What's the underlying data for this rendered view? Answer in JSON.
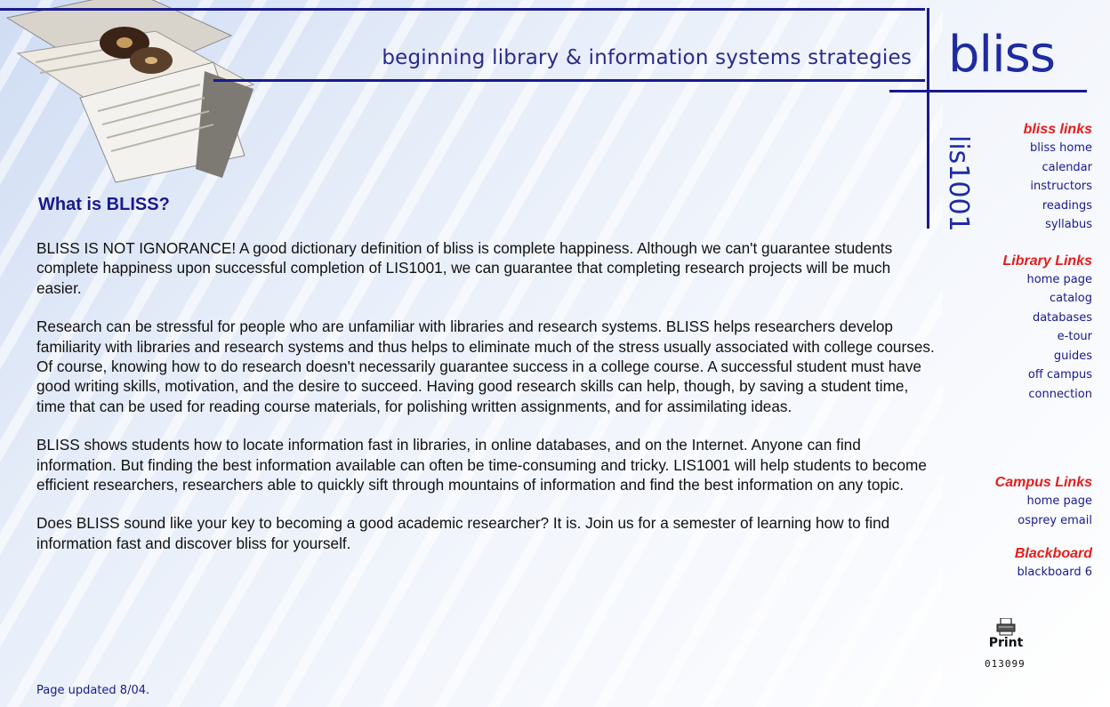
{
  "header": {
    "tagline": "beginning library & information systems strategies",
    "logo": "bliss",
    "course_code": "lis1001"
  },
  "main": {
    "title": "What is BLISS?",
    "paragraphs": [
      "BLISS IS NOT IGNORANCE! A good dictionary definition of bliss is complete happiness. Although we can't guarantee students complete happiness upon successful completion of LIS1001, we can guarantee that completing research projects will be much easier.",
      "Research can be stressful for people who are unfamiliar with libraries and research systems. BLISS helps researchers develop familiarity with libraries and research systems and thus helps to eliminate much of the stress usually associated with college courses. Of course, knowing how to do research doesn't necessarily guarantee success in a college course. A successful student must have good writing skills, motivation, and the desire to succeed. Having good research skills can help, though, by saving a student time, time that can be used for reading course materials, for polishing written assignments, and for assimilating ideas.",
      "BLISS shows students how to locate information fast in libraries, in online databases, and on the Internet. Anyone can find information. But finding the best information available can often be time-consuming and tricky. LIS1001 will help students to become efficient researchers, researchers able to quickly sift through mountains of information and find the best information on any topic.",
      "Does BLISS sound like your key to becoming a good academic researcher? It is. Join us for a semester of learning how to find information fast and discover bliss for yourself."
    ],
    "updated": "Page updated 8/04."
  },
  "sidebar": {
    "bliss_links": {
      "heading": "bliss links",
      "items": [
        "bliss home",
        "calendar",
        "instructors",
        "readings",
        "syllabus"
      ]
    },
    "library_links": {
      "heading": "Library Links",
      "items": [
        "home page",
        "catalog",
        "databases",
        "e-tour",
        "guides",
        "off campus",
        "connection"
      ]
    },
    "campus_links": {
      "heading": "Campus Links",
      "items": [
        "home page",
        "osprey email"
      ]
    },
    "blackboard": {
      "heading": "Blackboard",
      "items": [
        "blackboard 6"
      ]
    },
    "print_label": "Print",
    "counter": "013099"
  },
  "colors": {
    "navy": "#1a1a8c",
    "accent_red": "#e41d1d",
    "text": "#111111"
  }
}
